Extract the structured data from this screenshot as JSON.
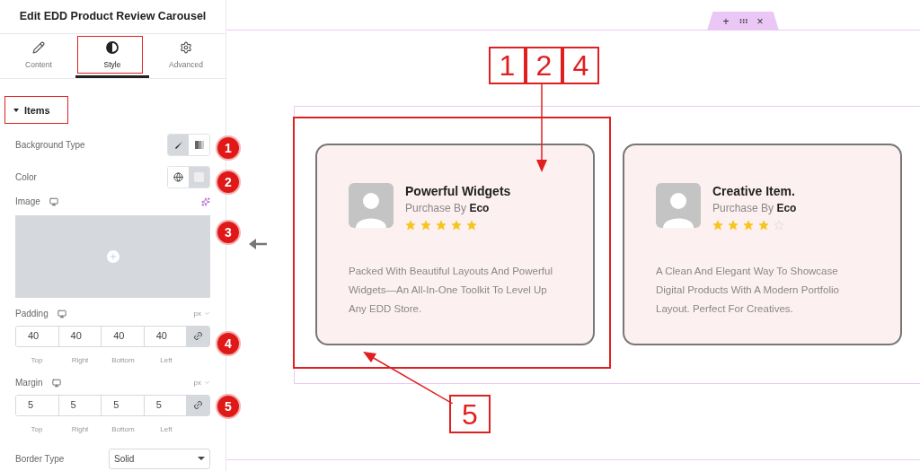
{
  "panel": {
    "title": "Edit EDD Product Review Carousel",
    "tabs": [
      {
        "label": "Content",
        "selected": false,
        "kind": "pencil"
      },
      {
        "label": "Style",
        "selected": true,
        "kind": "contrast"
      },
      {
        "label": "Advanced",
        "selected": false,
        "kind": "gear"
      }
    ],
    "section": {
      "label": "Items",
      "expanded": true
    },
    "background_type": {
      "label": "Background Type",
      "options": [
        {
          "kind": "solid",
          "selected": true
        },
        {
          "kind": "gradient",
          "selected": false
        }
      ]
    },
    "color": {
      "label": "Color"
    },
    "image": {
      "label": "Image"
    },
    "padding": {
      "label": "Padding",
      "unit": "px",
      "values": [
        {
          "value": "40",
          "label": "Top"
        },
        {
          "value": "40",
          "label": "Right"
        },
        {
          "value": "40",
          "label": "Bottom"
        },
        {
          "value": "40",
          "label": "Left"
        }
      ]
    },
    "margin": {
      "label": "Margin",
      "unit": "px",
      "values": [
        {
          "value": "5",
          "label": "Top"
        },
        {
          "value": "5",
          "label": "Right"
        },
        {
          "value": "5",
          "label": "Bottom"
        },
        {
          "value": "5",
          "label": "Left"
        }
      ]
    },
    "border_type": {
      "label": "Border Type",
      "value": "Solid"
    }
  },
  "canvas": {
    "toolbar": [
      "+",
      "×"
    ],
    "cards": [
      {
        "title": "Powerful Widgets",
        "purchase_label": "Purchase By",
        "buyer": "Eco",
        "stars": 5,
        "text_lines": [
          "Packed With Beautiful Layouts And Powerful",
          "Widgets—An All-In-One Toolkit To Level Up",
          "Any EDD Store."
        ]
      },
      {
        "title": "Creative Item.",
        "purchase_label": "Purchase By",
        "buyer": "Eco",
        "stars": 4,
        "text_lines": [
          "A Clean And Elegant Way To Showcase",
          "Digital Products With A Modern Portfolio",
          "Layout. Perfect For Creatives."
        ]
      }
    ]
  },
  "annotations": {
    "badges": [
      "1",
      "2",
      "3",
      "4",
      "5"
    ],
    "callouts": [
      "1",
      "2",
      "4"
    ],
    "bottom_callout": "5"
  }
}
